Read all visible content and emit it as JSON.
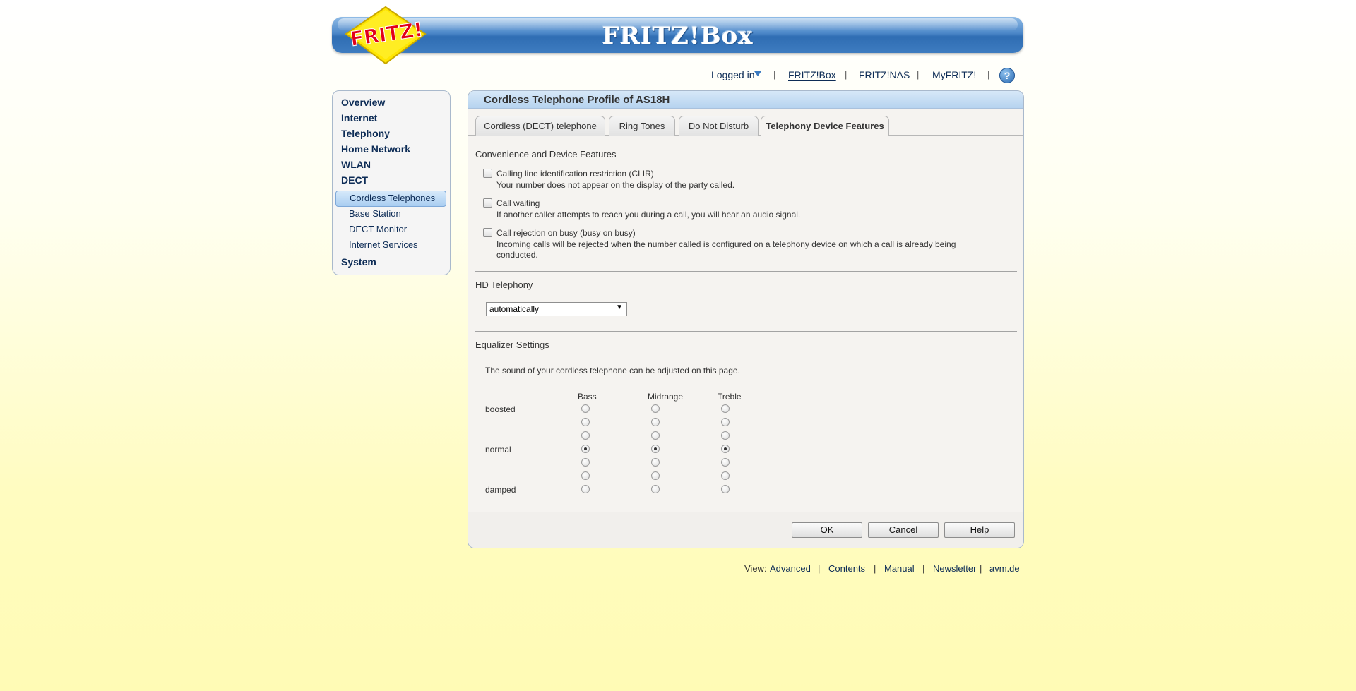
{
  "header": {
    "brand_title": "FRITZ!Box",
    "logo_text": "FRITZ!",
    "colors": {
      "header_blue": "#3e7cc0",
      "logo_yellow": "#ffe600",
      "logo_red": "#e2001a"
    }
  },
  "topnav": {
    "login_label": "Logged in",
    "links": [
      "FRITZ!Box",
      "FRITZ!NAS",
      "MyFRITZ!"
    ],
    "selected": "FRITZ!Box",
    "help_icon": "?"
  },
  "sidebar": {
    "items": [
      "Overview",
      "Internet",
      "Telephony",
      "Home Network",
      "WLAN",
      "DECT"
    ],
    "dect_subitems": [
      "Cordless Telephones",
      "Base Station",
      "DECT Monitor",
      "Internet Services"
    ],
    "selected_subitem": "Cordless Telephones",
    "last_item": "System"
  },
  "main": {
    "title": "Cordless Telephone Profile of AS18H",
    "tabs": [
      "Cordless (DECT) telephone",
      "Ring Tones",
      "Do Not Disturb",
      "Telephony Device Features"
    ],
    "active_tab": "Telephony Device Features",
    "convenience": {
      "title": "Convenience and Device Features",
      "options": [
        {
          "label": "Calling line identification restriction (CLIR)",
          "desc": "Your number does not appear on the display of the party called.",
          "checked": false
        },
        {
          "label": "Call waiting",
          "desc": "If another caller attempts to reach you during a call, you will hear an audio signal.",
          "checked": false
        },
        {
          "label": "Call rejection on busy (busy on busy)",
          "desc": "Incoming calls will be rejected when the number called is configured on a telephony device on which a call is already being conducted.",
          "checked": false
        }
      ]
    },
    "hd": {
      "title": "HD Telephony",
      "selected": "automatically"
    },
    "equalizer": {
      "title": "Equalizer Settings",
      "intro": "The sound of your cordless telephone can be adjusted on this page.",
      "columns": [
        "Bass",
        "Midrange",
        "Treble"
      ],
      "row_labels": {
        "top": "boosted",
        "middle": "normal",
        "bottom": "damped"
      },
      "levels": 7,
      "selected_level_index": [
        3,
        3,
        3
      ]
    },
    "buttons": {
      "ok": "OK",
      "cancel": "Cancel",
      "help": "Help"
    }
  },
  "footer": {
    "view_label": "View:",
    "view_value": "Advanced",
    "links": [
      "Contents",
      "Manual",
      "Newsletter",
      "avm.de"
    ]
  }
}
